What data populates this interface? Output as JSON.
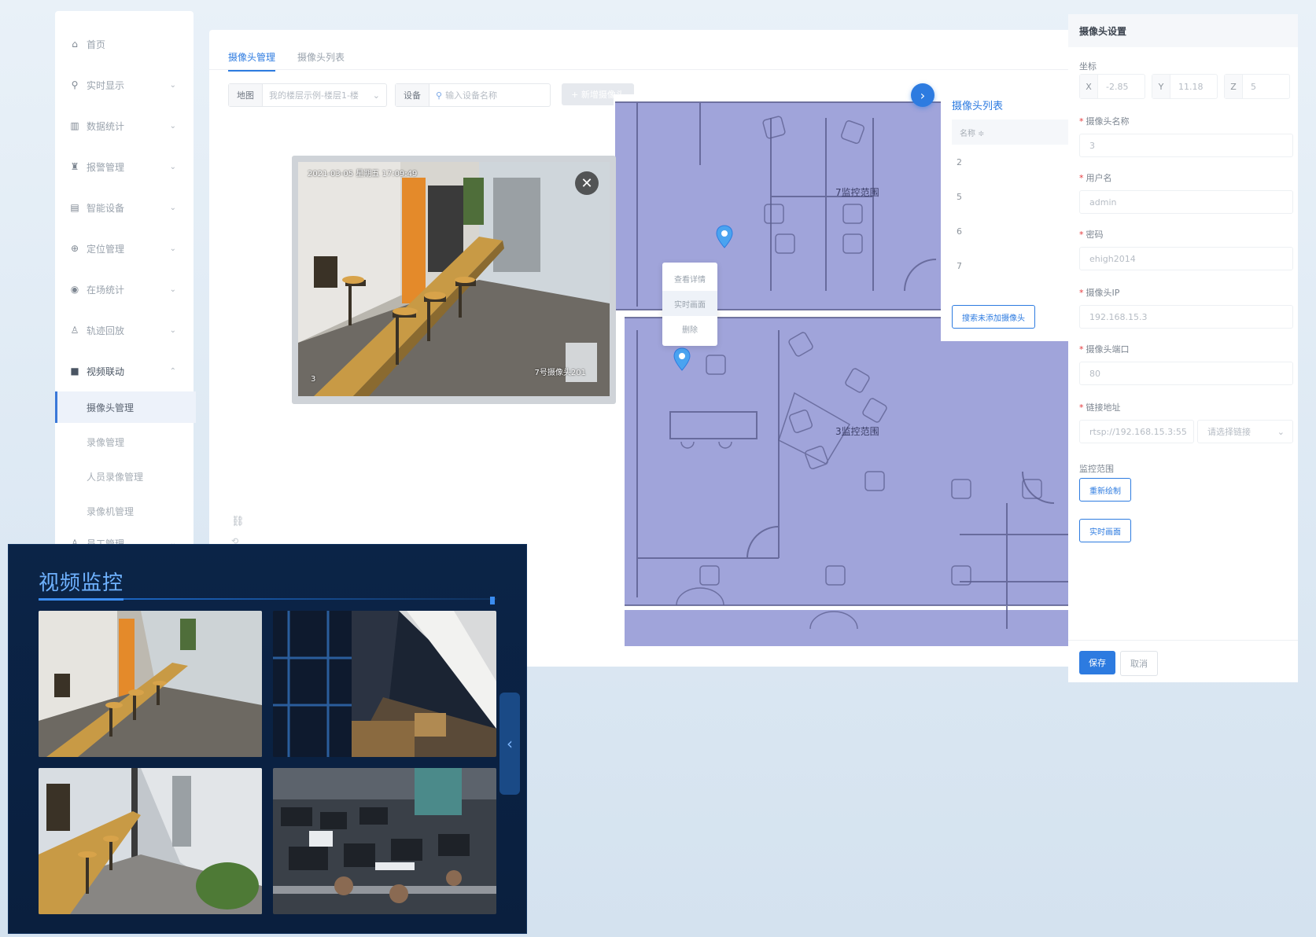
{
  "sidebar": {
    "home": "首页",
    "items": [
      {
        "label": "实时显示"
      },
      {
        "label": "数据统计"
      },
      {
        "label": "报警管理"
      },
      {
        "label": "智能设备"
      },
      {
        "label": "定位管理"
      },
      {
        "label": "在场统计"
      },
      {
        "label": "轨迹回放"
      },
      {
        "label": "视频联动"
      }
    ],
    "subitems": [
      {
        "label": "摄像头管理"
      },
      {
        "label": "录像管理"
      },
      {
        "label": "人员录像管理"
      },
      {
        "label": "录像机管理"
      }
    ],
    "last_item": "员工管理"
  },
  "tabs": [
    "摄像头管理",
    "摄像头列表"
  ],
  "filters": {
    "map_label": "地图",
    "map_value": "我的楼层示例-楼层1-楼",
    "device_label": "设备",
    "device_placeholder": "输入设备名称",
    "add_button": "+ 新增摄像头"
  },
  "video": {
    "timestamp": "2021-03-05 星期五 17:09:49",
    "camera_name": "7号摄像头201",
    "corner_num": "3"
  },
  "floorplan": {
    "zone_a": "7监控范围",
    "zone_b": "3监控范围"
  },
  "context_menu": [
    "查看详情",
    "实时画面",
    "删除"
  ],
  "camera_list": {
    "title": "摄像头列表",
    "header": "名称 ≑",
    "rows": [
      "2",
      "5",
      "6",
      "7"
    ],
    "search_button": "搜索未添加摄像头"
  },
  "settings": {
    "title": "摄像头设置",
    "coord_label": "坐标",
    "x_label": "X",
    "x_value": "-2.85",
    "y_label": "Y",
    "y_value": "11.18",
    "z_label": "Z",
    "z_value": "5",
    "name_label": "摄像头名称",
    "name_value": "3",
    "user_label": "用户名",
    "user_value": "admin",
    "pwd_label": "密码",
    "pwd_value": "ehigh2014",
    "ip_label": "摄像头IP",
    "ip_value": "192.168.15.3",
    "port_label": "摄像头端口",
    "port_value": "80",
    "url_label": "链接地址",
    "url_value": "rtsp://192.168.15.3:55",
    "url_select": "请选择链接",
    "range_label": "监控范围",
    "redraw_button": "重新绘制",
    "live_button": "实时画面",
    "save_button": "保存",
    "cancel_button": "取消"
  },
  "monitor": {
    "title": "视频监控"
  },
  "colors": {
    "primary": "#2d7be0",
    "plan_fill": "#9b9fd8",
    "monitor_bg": "#0b2447"
  }
}
